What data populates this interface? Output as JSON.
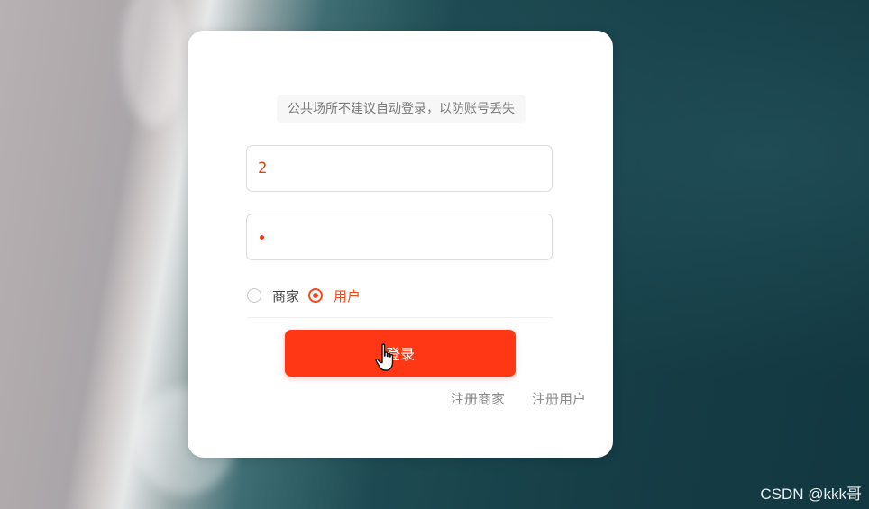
{
  "login": {
    "tip": "公共场所不建议自动登录，以防账号丢失",
    "username_value": "2",
    "roles": [
      {
        "label": "商家",
        "selected": false
      },
      {
        "label": "用户",
        "selected": true
      }
    ],
    "login_button": "登录",
    "register_merchant": "注册商家",
    "register_user": "注册用户"
  },
  "watermark": "CSDN @kkk哥",
  "colors": {
    "accent": "#ff3714",
    "text_accent": "#e0440e",
    "ocean": "#163e47"
  }
}
